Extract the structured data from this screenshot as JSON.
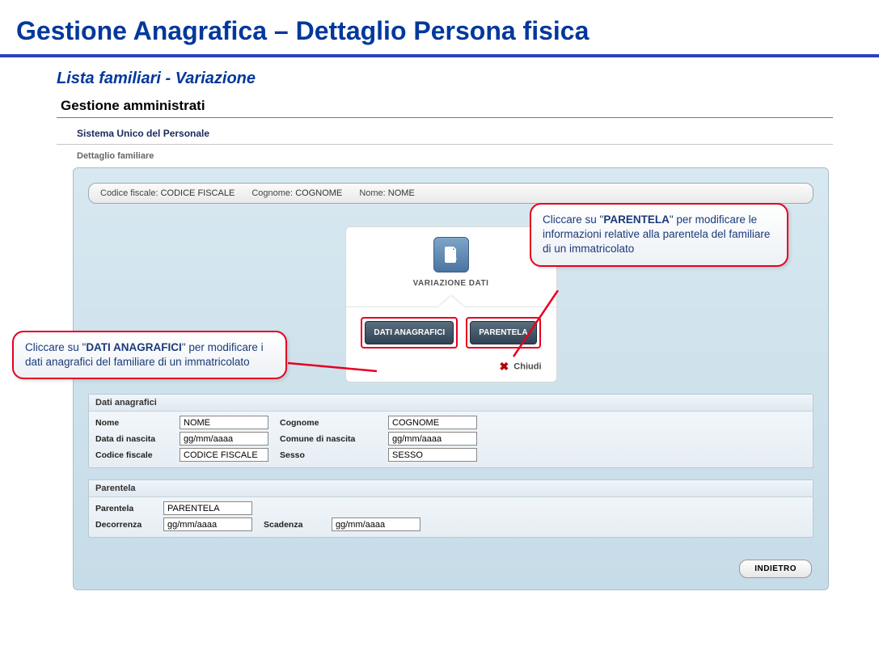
{
  "slide": {
    "title": "Gestione Anagrafica – Dettaglio Persona fisica",
    "subtitle": "Lista familiari - Variazione"
  },
  "app": {
    "heading": "Gestione amministrati",
    "system": "Sistema Unico del Personale",
    "breadcrumb": "Dettaglio familiare"
  },
  "identity": {
    "cf_label": "Codice fiscale:",
    "cf_value": "CODICE FISCALE",
    "cognome_label": "Cognome:",
    "cognome_value": "COGNOME",
    "nome_label": "Nome:",
    "nome_value": "NOME"
  },
  "modal": {
    "title": "VARIAZIONE DATI",
    "btn_anagrafici": "DATI ANAGRAFICI",
    "btn_parentela": "PARENTELA",
    "close": "Chiudi"
  },
  "sections": {
    "anagrafici_head": "Dati anagrafici",
    "parentela_head": "Parentela",
    "fields": {
      "nome_label": "Nome",
      "nome_value": "NOME",
      "cognome_label": "Cognome",
      "cognome_value": "COGNOME",
      "nascita_label": "Data di nascita",
      "nascita_value": "gg/mm/aaaa",
      "comune_label": "Comune di nascita",
      "comune_value": "gg/mm/aaaa",
      "cf_label": "Codice fiscale",
      "cf_value": "CODICE FISCALE",
      "sesso_label": "Sesso",
      "sesso_value": "SESSO",
      "parentela_label": "Parentela",
      "parentela_value": "PARENTELA",
      "decorrenza_label": "Decorrenza",
      "decorrenza_value": "gg/mm/aaaa",
      "scadenza_label": "Scadenza",
      "scadenza_value": "gg/mm/aaaa"
    }
  },
  "buttons": {
    "back": "INDIETRO"
  },
  "callouts": {
    "left_pre": "Cliccare su \"",
    "left_bold": "DATI ANAGRAFICI",
    "left_post": "\" per modificare i dati anagrafici del familiare di un immatricolato",
    "right_pre": "Cliccare su \"",
    "right_bold": "PARENTELA",
    "right_post": "\" per modificare le informazioni relative alla parentela del familiare di un immatricolato"
  }
}
